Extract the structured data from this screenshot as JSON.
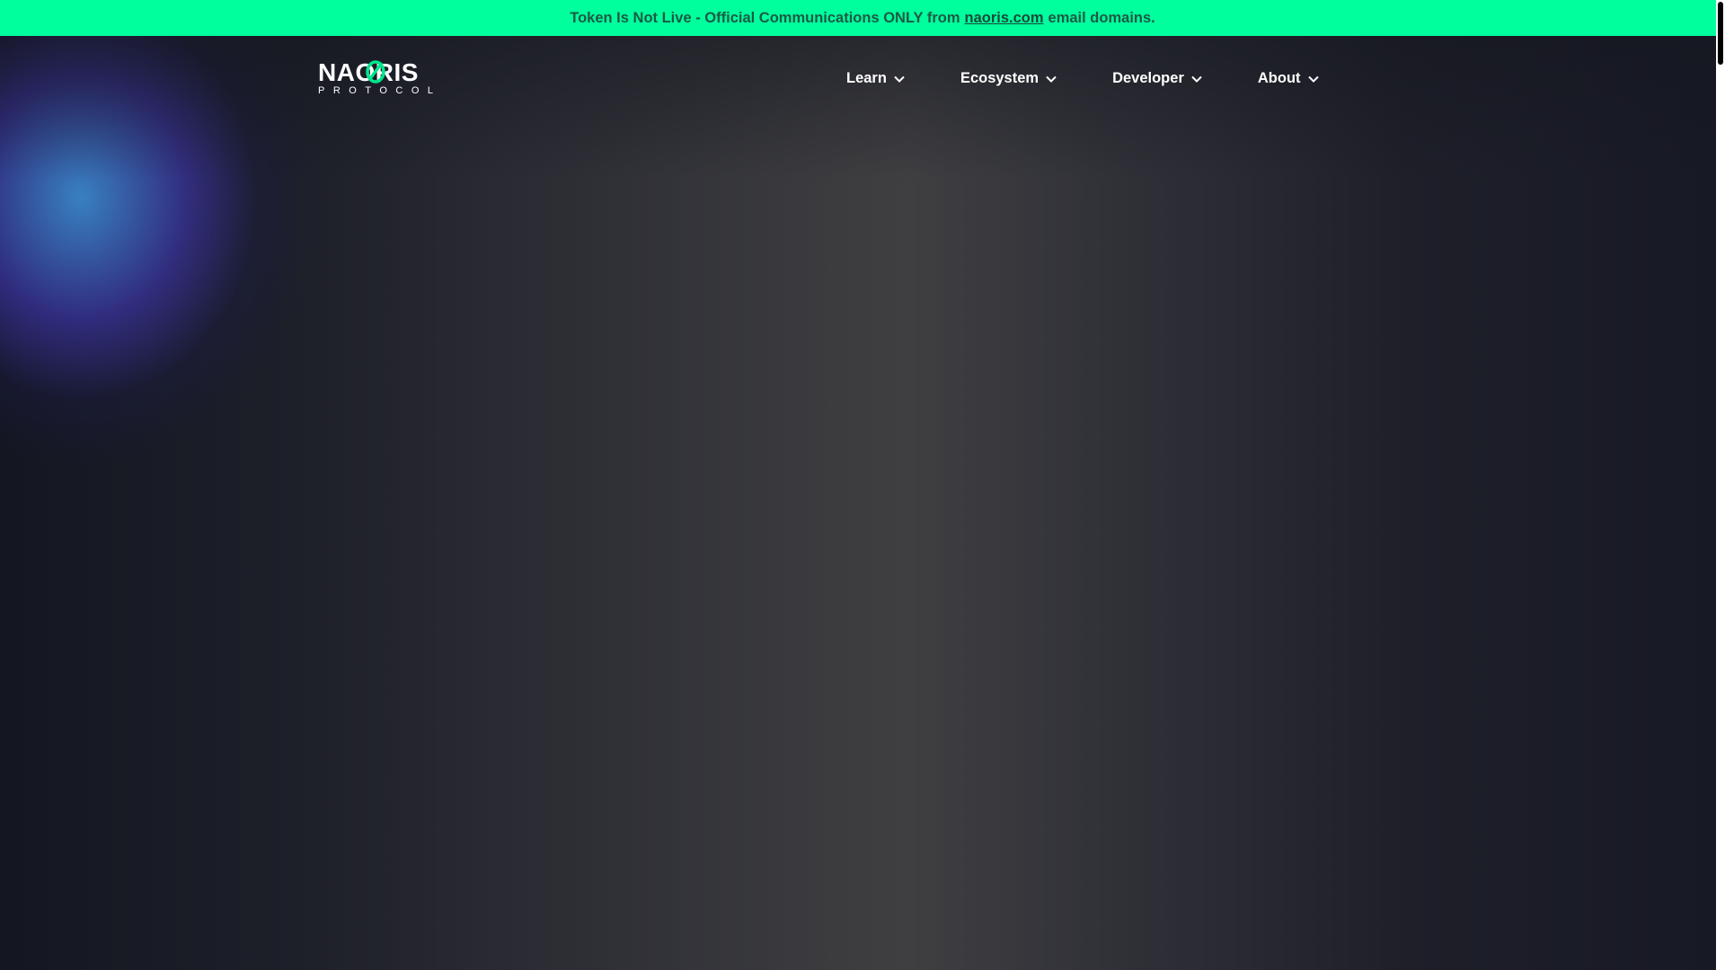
{
  "announcement": {
    "prefix": "Token Is Not Live - Official Communications ONLY from",
    "link": "naoris.com",
    "suffix": "email domains."
  },
  "logo": {
    "wordmark": "NAORIS",
    "subtitle": "PROTOCOL",
    "icon": "naoris-protocol-logo"
  },
  "nav": {
    "items": [
      {
        "label": "Learn",
        "icon": "chevron-down-icon"
      },
      {
        "label": "Ecosystem",
        "icon": "chevron-down-icon"
      },
      {
        "label": "Developer",
        "icon": "chevron-down-icon"
      },
      {
        "label": "About",
        "icon": "chevron-down-icon"
      }
    ]
  },
  "colors": {
    "announcement_bg": "#00ff9d",
    "announcement_text": "#1d5a44",
    "accent": "#00e68c",
    "nav_text": "#ffffff",
    "page_bg": "#15171f"
  }
}
